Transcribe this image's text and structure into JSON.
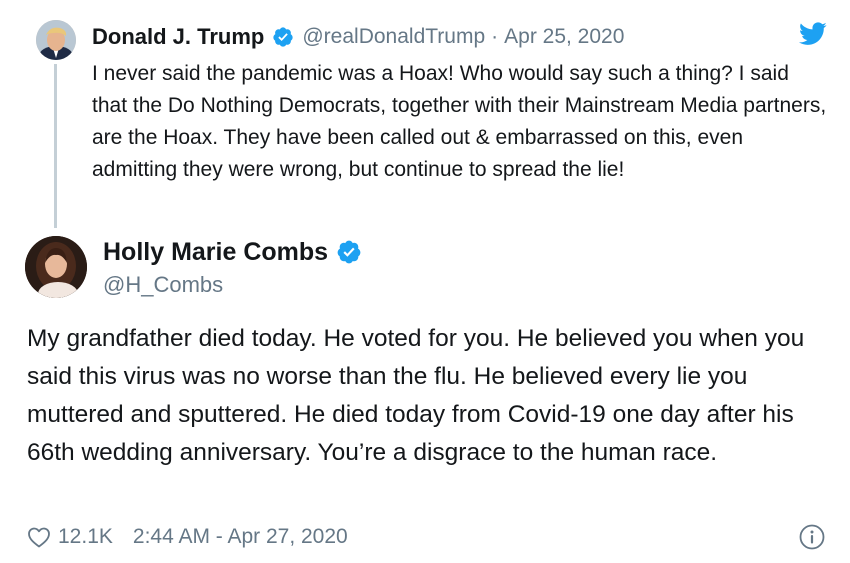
{
  "quoted_tweet": {
    "author_name": "Donald J. Trump",
    "handle": "@realDonaldTrump",
    "separator": "·",
    "date": "Apr 25, 2020",
    "text": "I never said the pandemic was a Hoax! Who would say such a thing? I said that the Do Nothing Democrats, together with their Mainstream Media partners, are the Hoax. They have been called out & embarrassed on this, even admitting they were wrong, but continue to spread the lie!",
    "avatar_icon": "avatar-photo",
    "verified_icon": "verified-badge-icon"
  },
  "tweet": {
    "author_name": "Holly Marie Combs",
    "handle": "@H_Combs",
    "text": "My grandfather died today. He voted for you. He believed you when you said this virus was no worse than the flu. He believed every lie you muttered and sputtered. He died today from Covid-19 one day after his 66th wedding anniversary. You’re a disgrace to the human race.",
    "avatar_icon": "avatar-photo",
    "verified_icon": "verified-badge-icon"
  },
  "footer": {
    "like_icon": "heart-icon",
    "like_count": "12.1K",
    "timestamp": "2:44 AM - Apr 27, 2020",
    "info_icon": "info-icon"
  },
  "brand": {
    "logo_icon": "twitter-bird-icon",
    "accent_color": "#1DA1F2",
    "text_color": "#14171A",
    "secondary_text_color": "#657786",
    "thread_line_color": "#C4CFD6"
  }
}
